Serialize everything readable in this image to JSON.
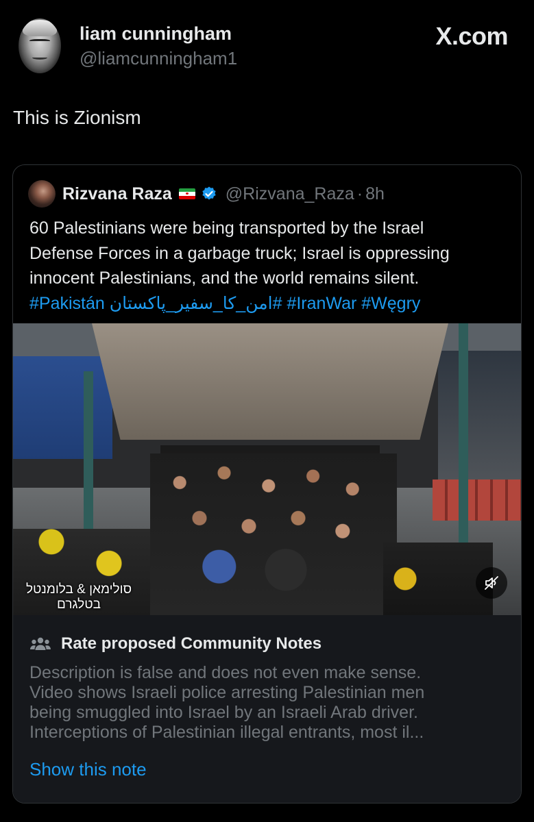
{
  "post": {
    "author_name": "liam cunningham",
    "author_handle": "@liamcunningham1",
    "brand": "X.com",
    "text": "This is Zionism"
  },
  "quote": {
    "author_name": "Rizvana Raza",
    "author_handle": "@Rizvana_Raza",
    "separator": "·",
    "time": "8h",
    "flag": "iran-flag",
    "verified_color": "#1d9bf0",
    "body_lines": [
      "60 Palestinians were being transported by the Israel",
      "Defense Forces in a garbage truck; Israel is oppressing",
      "innocent Palestinians, and the world remains silent."
    ],
    "hashtags": [
      "#Pakistán",
      "#امن_کا_سفیر_پاکستان",
      "#IranWar",
      "#Węgry"
    ],
    "media": {
      "watermark_line1": "סולימאן & בלומנטל",
      "watermark_line2": "בטלגרם",
      "mute_icon": "speaker-muted-icon"
    }
  },
  "community_notes": {
    "icon": "people-icon",
    "title": "Rate proposed Community Notes",
    "body_lines": [
      "Description is false and does not even make sense.",
      "Video shows Israeli police arresting Palestinian men",
      "being smuggled into Israel by an Israeli Arab driver.",
      "Interceptions of Palestinian illegal entrants, most il..."
    ],
    "show_note_label": "Show this note"
  },
  "colors": {
    "background": "#000000",
    "primary_text": "#e7e9ea",
    "secondary_text": "#71767b",
    "link": "#1d9bf0",
    "card_border": "#2f3336",
    "notes_bg": "#16181c"
  }
}
